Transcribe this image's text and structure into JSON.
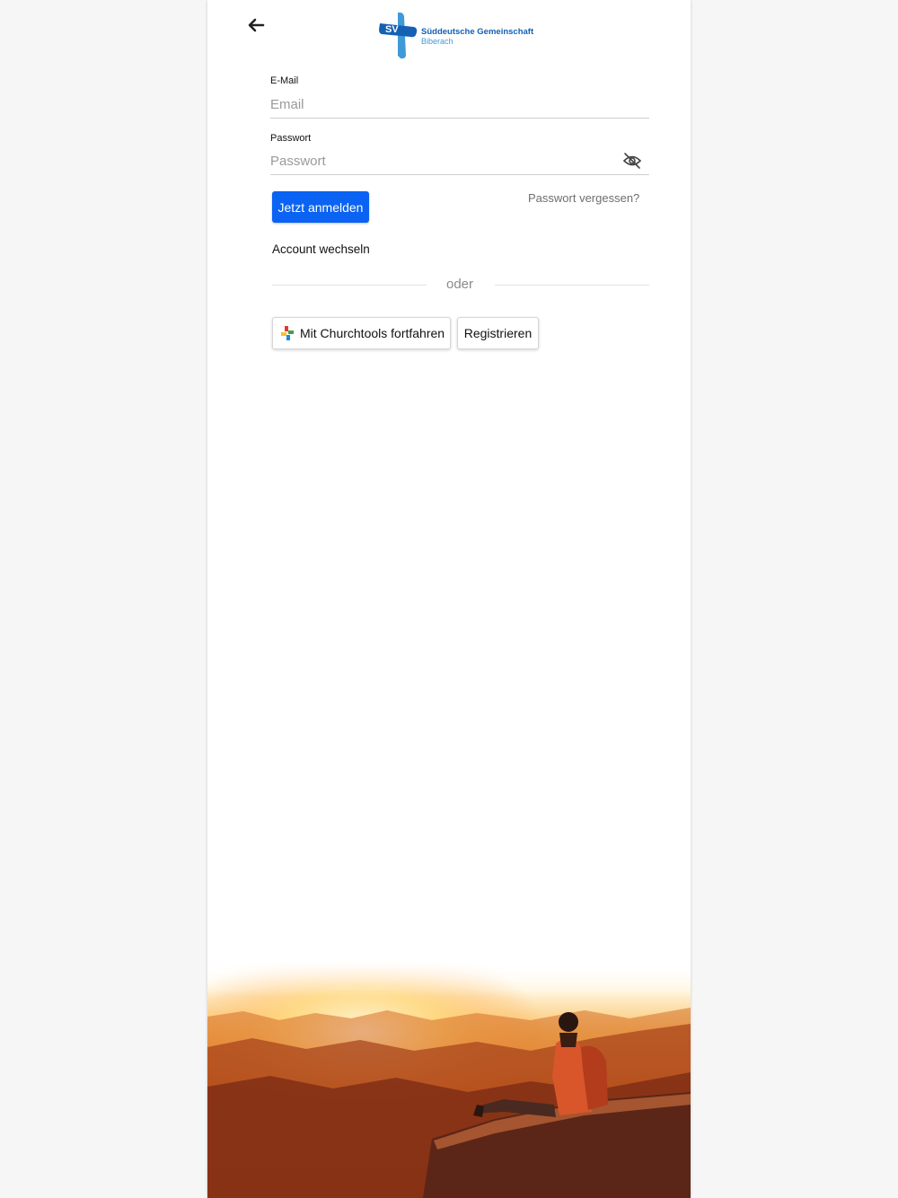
{
  "header": {
    "back_icon": "arrow-left-icon",
    "logo": {
      "mark_text": "SV",
      "name": "Süddeutsche Gemeinschaft",
      "subtitle": "Biberach",
      "brand_blue": "#1460b4",
      "light_blue": "#3f9ad8"
    }
  },
  "form": {
    "email": {
      "label": "E-Mail",
      "placeholder": "Email",
      "value": ""
    },
    "password": {
      "label": "Passwort",
      "placeholder": "Passwort",
      "value": "",
      "toggle_icon": "eye-slash-icon"
    },
    "login_button": "Jetzt anmelden",
    "forgot_link": "Passwort vergessen?",
    "switch_account": "Account wechseln"
  },
  "divider": {
    "text": "oder"
  },
  "alt_actions": {
    "churchtools_button": "Mit Churchtools fortfahren",
    "churchtools_icon": "churchtools-logo-icon",
    "register_button": "Registrieren"
  },
  "hero": {
    "icon": "hiker-sunset-image"
  },
  "colors": {
    "primary": "#0a63f2",
    "text": "#111111",
    "muted": "#8a8a8a"
  }
}
